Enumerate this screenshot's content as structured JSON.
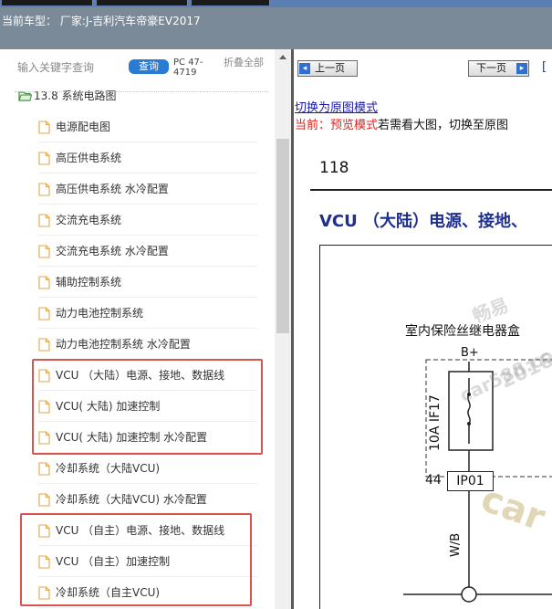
{
  "header": {
    "car_model": "当前车型： 厂家:J-吉利汽车帝豪EV2017"
  },
  "sidebar": {
    "search_placeholder": "输入关键字查询",
    "query_button": "查询",
    "pc_code": "PC 47-4719",
    "collapse_all": "折叠全部",
    "root": "13.8 系统电路图",
    "items": [
      {
        "label": "电源配电图"
      },
      {
        "label": "高压供电系统"
      },
      {
        "label": "高压供电系统 水冷配置"
      },
      {
        "label": "交流充电系统"
      },
      {
        "label": "交流充电系统 水冷配置"
      },
      {
        "label": "辅助控制系统"
      },
      {
        "label": "动力电池控制系统"
      },
      {
        "label": "动力电池控制系统 水冷配置"
      },
      {
        "label": "VCU （大陆）电源、接地、数据线"
      },
      {
        "label": "VCU( 大陆) 加速控制"
      },
      {
        "label": "VCU( 大陆) 加速控制 水冷配置"
      },
      {
        "label": "冷却系统（大陆VCU)"
      },
      {
        "label": "冷却系统（大陆VCU) 水冷配置"
      },
      {
        "label": "VCU （自主）电源、接地、数据线"
      },
      {
        "label": "VCU （自主）加速控制"
      },
      {
        "label": "冷却系统（自主VCU)"
      }
    ]
  },
  "content": {
    "prev_button": "上一页",
    "next_button": "下一页",
    "switch_link": "切换为原图模式",
    "current_label": "当前：预览模式",
    "current_hint": "若需看大图，切换至原图",
    "page_number": "118",
    "diagram_title": "VCU （大陆）电源、接地、",
    "fuse_box_title": "室内保险丝继电器盒",
    "bplus": "B+",
    "fuse_rating": "10A  IF17",
    "pin_number": "44",
    "pin_label": "IP01",
    "wire_code": "W/B",
    "watermark_1": "畅易",
    "watermark_2": "car588.co",
    "watermark_3": "2016",
    "watermark_4": "car"
  },
  "colors": {
    "header_bg": "#7b8a99",
    "accent_blue": "#2a7bd3",
    "highlight_red": "#d9534f",
    "title_blue": "#1f2f8f",
    "mode_red": "#e0201b"
  }
}
